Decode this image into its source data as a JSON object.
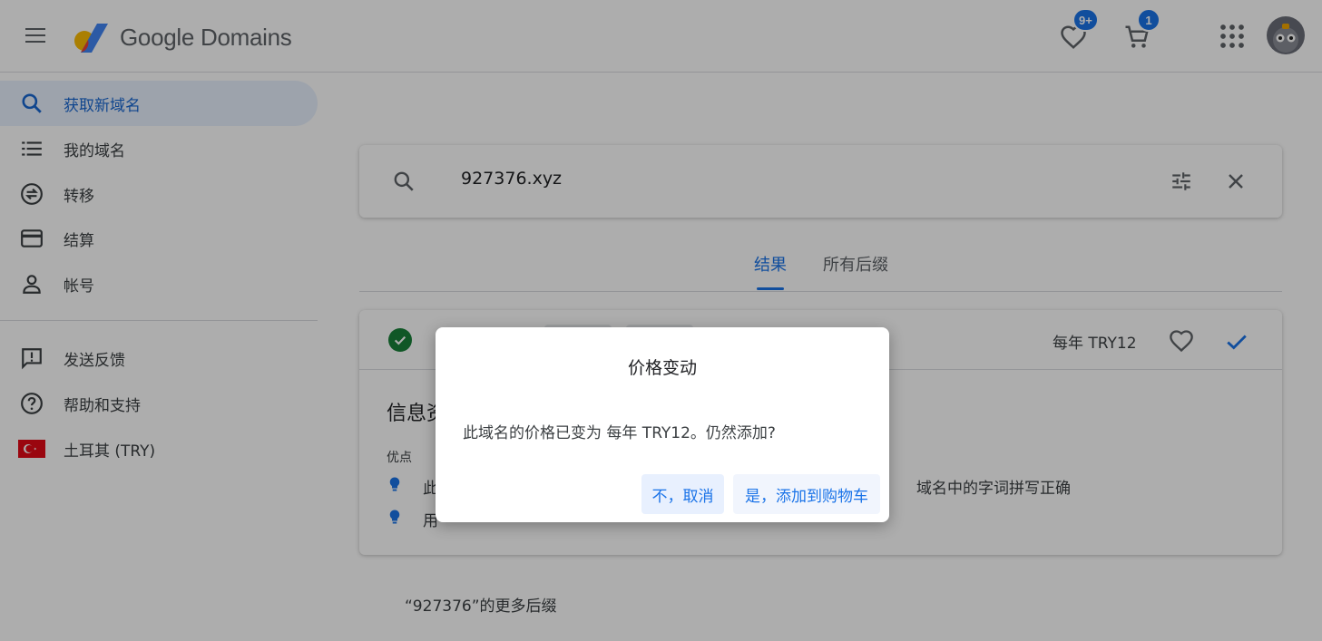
{
  "header": {
    "logo_text": "Google Domains",
    "wishlist_badge": "9+",
    "cart_badge": "1"
  },
  "sidebar": {
    "items": [
      {
        "label": "获取新域名",
        "icon": "search-icon",
        "active": true
      },
      {
        "label": "我的域名",
        "icon": "list-icon"
      },
      {
        "label": "转移",
        "icon": "transfer-icon"
      },
      {
        "label": "结算",
        "icon": "credit-card-icon"
      },
      {
        "label": "帐号",
        "icon": "person-icon"
      }
    ],
    "secondary": [
      {
        "label": "发送反馈",
        "icon": "feedback-icon"
      },
      {
        "label": "帮助和支持",
        "icon": "help-icon"
      },
      {
        "label": "土耳其 (TRY)",
        "icon": "turkey-flag-icon"
      }
    ]
  },
  "search": {
    "value": "927376.xyz"
  },
  "tabs": [
    {
      "label": "结果",
      "active": true
    },
    {
      "label": "所有后缀"
    }
  ],
  "result": {
    "price": "每年 TRY12",
    "info_title": "信息资",
    "pros_label": "优点",
    "tips": [
      {
        "text_left": "此",
        "text_right": "域名中的字词拼写正确"
      },
      {
        "text_left": "用"
      }
    ]
  },
  "more_suffixes": "“927376”的更多后缀",
  "dialog": {
    "title": "价格变动",
    "body": "此域名的价格已变为 每年 TRY12。仍然添加?",
    "cancel_label": "不，取消",
    "confirm_label": "是，添加到购物车"
  },
  "colors": {
    "accent": "#1a73e8",
    "success": "#188038",
    "scrim": "rgba(0,0,0,0.32)"
  }
}
